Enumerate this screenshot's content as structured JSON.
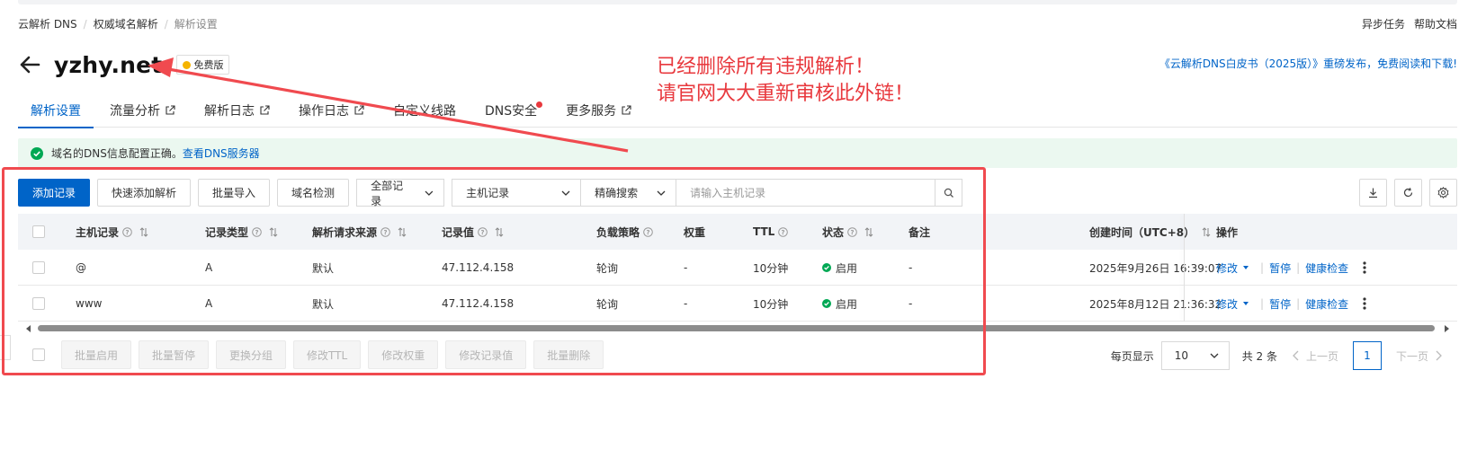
{
  "breadcrumb": [
    "云解析 DNS",
    "权威域名解析",
    "解析设置"
  ],
  "top_links": [
    "异步任务",
    "帮助文档"
  ],
  "domain": "yzhy.net",
  "badge": "免费版",
  "whitepaper": "《云解析DNS白皮书（2025版）》重磅发布，免费阅读和下载!",
  "annotation": [
    "已经删除所有违规解析！",
    "请官网大大重新审核此外链！"
  ],
  "tabs": [
    {
      "label": "解析设置",
      "external": false,
      "active": true
    },
    {
      "label": "流量分析",
      "external": true
    },
    {
      "label": "解析日志",
      "external": true
    },
    {
      "label": "操作日志",
      "external": true
    },
    {
      "label": "自定义线路",
      "external": false
    },
    {
      "label": "DNS安全",
      "external": false,
      "dot": true
    },
    {
      "label": "更多服务",
      "external": true
    }
  ],
  "alert": {
    "text": "域名的DNS信息配置正确。",
    "link": "查看DNS服务器"
  },
  "toolbar": {
    "add": "添加记录",
    "quick_add": "快速添加解析",
    "import": "批量导入",
    "check": "域名检测",
    "filter": "全部记录",
    "field": "主机记录",
    "match": "精确搜索",
    "placeholder": "请输入主机记录"
  },
  "columns": {
    "host": "主机记录",
    "type": "记录类型",
    "source": "解析请求来源",
    "value": "记录值",
    "policy": "负载策略",
    "weight": "权重",
    "ttl": "TTL",
    "status": "状态",
    "remark": "备注",
    "created": "创建时间（UTC+8）",
    "ops": "操作"
  },
  "rows": [
    {
      "host": "@",
      "type": "A",
      "source": "默认",
      "value": "47.112.4.158",
      "policy": "轮询",
      "weight": "-",
      "ttl": "10分钟",
      "status": "启用",
      "remark": "-",
      "created": "2025年9月26日 16:39:07"
    },
    {
      "host": "www",
      "type": "A",
      "source": "默认",
      "value": "47.112.4.158",
      "policy": "轮询",
      "weight": "-",
      "ttl": "10分钟",
      "status": "启用",
      "remark": "-",
      "created": "2025年8月12日 21:36:32"
    }
  ],
  "row_ops": {
    "edit": "修改",
    "pause": "暂停",
    "health": "健康检查"
  },
  "bulk": [
    "批量启用",
    "批量暂停",
    "更换分组",
    "修改TTL",
    "修改权重",
    "修改记录值",
    "批量删除"
  ],
  "pager": {
    "per_page_label": "每页显示",
    "per_page": "10",
    "total": "共 2 条",
    "prev": "上一页",
    "current": "1",
    "next": "下一页"
  },
  "colors": {
    "primary": "#0064c8",
    "annotation": "#e8383d",
    "success": "#00a854"
  }
}
